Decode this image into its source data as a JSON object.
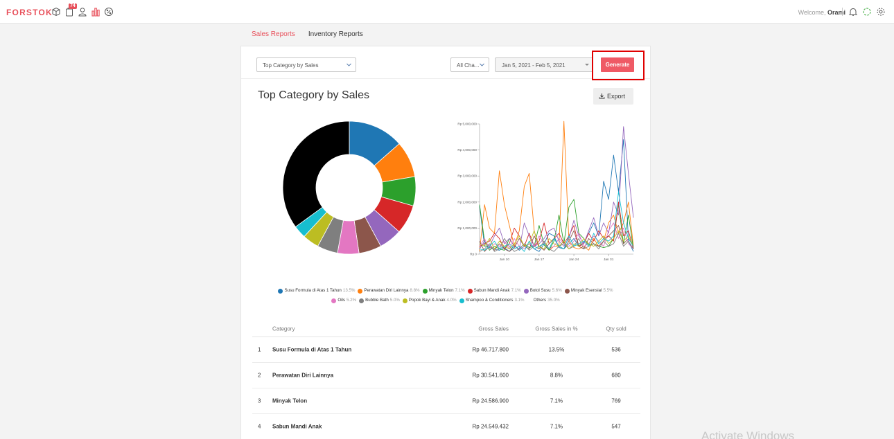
{
  "app": {
    "logo": "FORSTOK",
    "notification_count": "74",
    "welcome_prefix": "Welcome,",
    "user_name": "Orami",
    "watermark": "Activate Windows"
  },
  "tabs": [
    {
      "label": "Sales Reports",
      "active": true
    },
    {
      "label": "Inventory Reports",
      "active": false
    }
  ],
  "filters": {
    "report_type": "Top Category by Sales",
    "channel": "All Cha...",
    "date_range": "Jan 5, 2021 - Feb 5, 2021",
    "generate_label": "Generate"
  },
  "report": {
    "title": "Top Category by Sales",
    "export_label": "Export"
  },
  "colors": {
    "accent": "#e8505b",
    "highlight_outline": "#e00000"
  },
  "chart_data": [
    {
      "type": "pie",
      "variant": "donut",
      "categories": [
        "Susu Formula di Atas 1 Tahun",
        "Perawatan Diri Lainnya",
        "Minyak Telon",
        "Sabun Mandi Anak",
        "Botol Susu",
        "Minyak Esensial",
        "Oils",
        "Bubble Bath",
        "Popok Bayi & Anak",
        "Shampoo & Conditioners",
        "Others"
      ],
      "values": [
        13.5,
        8.8,
        7.1,
        7.1,
        5.6,
        5.5,
        5.2,
        5.0,
        4.0,
        3.1,
        35.0
      ],
      "colors": [
        "#1f77b4",
        "#ff7f0e",
        "#2ca02c",
        "#d62728",
        "#9467bd",
        "#8c564b",
        "#e377c2",
        "#7f7f7f",
        "#bcbd22",
        "#17becf",
        "#000000"
      ],
      "legend": [
        {
          "label": "Susu Formula di Atas 1 Tahun",
          "pct": "13.5%"
        },
        {
          "label": "Perawatan Diri Lainnya",
          "pct": "8.8%"
        },
        {
          "label": "Minyak Telon",
          "pct": "7.1%"
        },
        {
          "label": "Sabun Mandi Anak",
          "pct": "7.1%"
        },
        {
          "label": "Botol Susu",
          "pct": "5.6%"
        },
        {
          "label": "Minyak Esensial",
          "pct": "5.5%"
        },
        {
          "label": "Oils",
          "pct": "5.2%"
        },
        {
          "label": "Bubble Bath",
          "pct": "5.0%"
        },
        {
          "label": "Popok Bayi & Anak",
          "pct": "4.0%"
        },
        {
          "label": "Shampoo & Conditioners",
          "pct": "3.1%"
        },
        {
          "label": "Others",
          "pct": "35.0%"
        }
      ],
      "legend_placement": "bottom"
    },
    {
      "type": "line",
      "x_days": 32,
      "x_ticks": [
        {
          "day": 5,
          "label": "Jan 10"
        },
        {
          "day": 12,
          "label": "Jan 17"
        },
        {
          "day": 19,
          "label": "Jan 24"
        },
        {
          "day": 26,
          "label": "Jan 31"
        }
      ],
      "y_ticks": [
        "Rp 0",
        "Rp 1,000,000",
        "Rp 2,000,000",
        "Rp 3,000,000",
        "Rp 4,000,000",
        "Rp 5,000,000"
      ],
      "ylim": [
        0,
        5000000
      ],
      "grid": false,
      "series": [
        {
          "color": "#1f77b4",
          "values": [
            1850000,
            300000,
            250000,
            200000,
            150000,
            250000,
            100000,
            350000,
            150000,
            300000,
            400000,
            200000,
            100000,
            400000,
            800000,
            700000,
            250000,
            200000,
            400000,
            600000,
            300000,
            450000,
            800000,
            1200000,
            700000,
            2800000,
            2100000,
            3800000,
            2400000,
            4400000,
            500000,
            100000
          ]
        },
        {
          "color": "#ff7f0e",
          "values": [
            100000,
            1900000,
            1000000,
            800000,
            3200000,
            1900000,
            1100000,
            300000,
            900000,
            2600000,
            3100000,
            900000,
            200000,
            500000,
            150000,
            300000,
            300000,
            5100000,
            500000,
            250000,
            200000,
            300000,
            150000,
            600000,
            300000,
            500000,
            1200000,
            1500000,
            800000,
            1200000,
            2000000,
            300000
          ]
        },
        {
          "color": "#2ca02c",
          "values": [
            1900000,
            500000,
            150000,
            300000,
            200000,
            150000,
            600000,
            300000,
            200000,
            400000,
            250000,
            300000,
            1100000,
            350000,
            150000,
            500000,
            1500000,
            400000,
            1800000,
            2100000,
            800000,
            600000,
            350000,
            400000,
            300000,
            250000,
            300000,
            600000,
            1900000,
            400000,
            1500000,
            200000
          ]
        },
        {
          "color": "#d62728",
          "values": [
            300000,
            400000,
            500000,
            800000,
            600000,
            200000,
            400000,
            1000000,
            700000,
            300000,
            800000,
            300000,
            500000,
            1200000,
            400000,
            600000,
            800000,
            400000,
            700000,
            1100000,
            300000,
            400000,
            800000,
            500000,
            900000,
            600000,
            700000,
            500000,
            2000000,
            700000,
            900000,
            200000
          ]
        },
        {
          "color": "#9467bd",
          "values": [
            200000,
            500000,
            300000,
            700000,
            1000000,
            400000,
            600000,
            300000,
            200000,
            1200000,
            700000,
            300000,
            400000,
            600000,
            900000,
            1000000,
            500000,
            300000,
            600000,
            1300000,
            700000,
            400000,
            900000,
            1400000,
            700000,
            1200000,
            800000,
            2000000,
            1500000,
            4900000,
            3100000,
            1400000
          ]
        },
        {
          "color": "#8c564b",
          "values": [
            500000,
            100000,
            300000,
            150000,
            400000,
            200000,
            100000,
            250000,
            600000,
            300000,
            200000,
            700000,
            300000,
            150000,
            400000,
            600000,
            300000,
            200000,
            500000,
            900000,
            300000,
            200000,
            600000,
            400000,
            300000,
            500000,
            700000,
            900000,
            1100000,
            400000,
            600000,
            300000
          ]
        },
        {
          "color": "#e377c2",
          "values": [
            300000,
            600000,
            200000,
            400000,
            300000,
            500000,
            200000,
            600000,
            300000,
            200000,
            400000,
            300000,
            700000,
            400000,
            200000,
            300000,
            600000,
            400000,
            300000,
            500000,
            800000,
            300000,
            400000,
            700000,
            500000,
            300000,
            900000,
            1200000,
            600000,
            1000000,
            400000,
            200000
          ]
        },
        {
          "color": "#7f7f7f",
          "values": [
            100000,
            200000,
            400000,
            100000,
            200000,
            600000,
            300000,
            100000,
            200000,
            400000,
            150000,
            300000,
            200000,
            500000,
            200000,
            100000,
            300000,
            400000,
            200000,
            300000,
            600000,
            200000,
            300000,
            400000,
            200000,
            500000,
            300000,
            400000,
            800000,
            300000,
            500000,
            200000
          ]
        },
        {
          "color": "#bcbd22",
          "values": [
            400000,
            300000,
            600000,
            200000,
            500000,
            300000,
            200000,
            400000,
            700000,
            300000,
            400000,
            900000,
            300000,
            200000,
            600000,
            400000,
            300000,
            500000,
            200000,
            400000,
            300000,
            600000,
            400000,
            300000,
            500000,
            700000,
            400000,
            600000,
            900000,
            500000,
            700000,
            300000
          ]
        },
        {
          "color": "#17becf",
          "values": [
            200000,
            150000,
            300000,
            500000,
            200000,
            300000,
            400000,
            200000,
            300000,
            100000,
            500000,
            200000,
            300000,
            400000,
            200000,
            600000,
            300000,
            200000,
            700000,
            300000,
            400000,
            500000,
            300000,
            800000,
            400000,
            600000,
            500000,
            700000,
            2400000,
            1200000,
            600000,
            300000
          ]
        }
      ]
    }
  ],
  "table": {
    "headers": {
      "category": "Category",
      "gross": "Gross Sales",
      "pct": "Gross Sales in %",
      "qty": "Qty sold"
    },
    "rows": [
      {
        "no": "1",
        "category": "Susu Formula di Atas 1 Tahun",
        "gross": "Rp 46.717.800",
        "pct": "13.5%",
        "qty": "536"
      },
      {
        "no": "2",
        "category": "Perawatan Diri Lainnya",
        "gross": "Rp 30.541.600",
        "pct": "8.8%",
        "qty": "680"
      },
      {
        "no": "3",
        "category": "Minyak Telon",
        "gross": "Rp 24.586.900",
        "pct": "7.1%",
        "qty": "769"
      },
      {
        "no": "4",
        "category": "Sabun Mandi Anak",
        "gross": "Rp 24.549.432",
        "pct": "7.1%",
        "qty": "547"
      }
    ]
  }
}
